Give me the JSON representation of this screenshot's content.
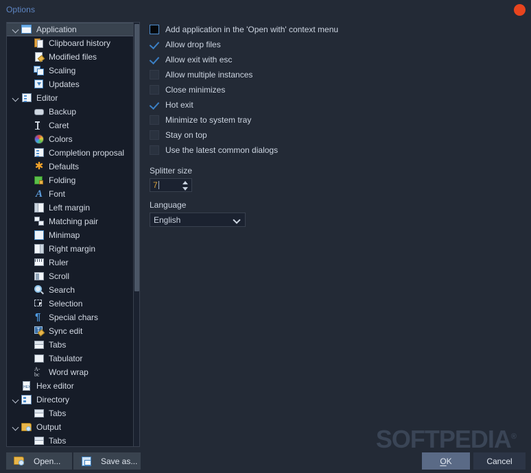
{
  "window": {
    "title": "Options",
    "close_icon": "close-circle-icon",
    "accent_close": "#e8441e",
    "accent_title": "#5e86c4",
    "background": "#232a36"
  },
  "tree": {
    "items": [
      {
        "label": "Application",
        "icon": "window-icon",
        "depth": 0,
        "expandable": true,
        "expanded": true,
        "selected": true
      },
      {
        "label": "Clipboard history",
        "icon": "clipboard-icon",
        "depth": 1,
        "expandable": false,
        "expanded": false,
        "selected": false
      },
      {
        "label": "Modified files",
        "icon": "document-edit-icon",
        "depth": 1,
        "expandable": false,
        "expanded": false,
        "selected": false
      },
      {
        "label": "Scaling",
        "icon": "scaling-icon",
        "depth": 1,
        "expandable": false,
        "expanded": false,
        "selected": false
      },
      {
        "label": "Updates",
        "icon": "updates-icon",
        "depth": 1,
        "expandable": false,
        "expanded": false,
        "selected": false
      },
      {
        "label": "Editor",
        "icon": "editor-icon",
        "depth": 0,
        "expandable": true,
        "expanded": true,
        "selected": false
      },
      {
        "label": "Backup",
        "icon": "backup-icon",
        "depth": 1,
        "expandable": false,
        "expanded": false,
        "selected": false
      },
      {
        "label": "Caret",
        "icon": "caret-icon",
        "depth": 1,
        "expandable": false,
        "expanded": false,
        "selected": false
      },
      {
        "label": "Colors",
        "icon": "colors-icon",
        "depth": 1,
        "expandable": false,
        "expanded": false,
        "selected": false
      },
      {
        "label": "Completion proposal",
        "icon": "completion-proposal-icon",
        "depth": 1,
        "expandable": false,
        "expanded": false,
        "selected": false
      },
      {
        "label": "Defaults",
        "icon": "defaults-icon",
        "depth": 1,
        "expandable": false,
        "expanded": false,
        "selected": false
      },
      {
        "label": "Folding",
        "icon": "folding-icon",
        "depth": 1,
        "expandable": false,
        "expanded": false,
        "selected": false
      },
      {
        "label": "Font",
        "icon": "font-icon",
        "depth": 1,
        "expandable": false,
        "expanded": false,
        "selected": false
      },
      {
        "label": "Left margin",
        "icon": "left-margin-icon",
        "depth": 1,
        "expandable": false,
        "expanded": false,
        "selected": false
      },
      {
        "label": "Matching pair",
        "icon": "matching-pair-icon",
        "depth": 1,
        "expandable": false,
        "expanded": false,
        "selected": false
      },
      {
        "label": "Minimap",
        "icon": "minimap-icon",
        "depth": 1,
        "expandable": false,
        "expanded": false,
        "selected": false
      },
      {
        "label": "Right margin",
        "icon": "right-margin-icon",
        "depth": 1,
        "expandable": false,
        "expanded": false,
        "selected": false
      },
      {
        "label": "Ruler",
        "icon": "ruler-icon",
        "depth": 1,
        "expandable": false,
        "expanded": false,
        "selected": false
      },
      {
        "label": "Scroll",
        "icon": "scroll-icon",
        "depth": 1,
        "expandable": false,
        "expanded": false,
        "selected": false
      },
      {
        "label": "Search",
        "icon": "search-icon",
        "depth": 1,
        "expandable": false,
        "expanded": false,
        "selected": false
      },
      {
        "label": "Selection",
        "icon": "selection-icon",
        "depth": 1,
        "expandable": false,
        "expanded": false,
        "selected": false
      },
      {
        "label": "Special chars",
        "icon": "pilcrow-icon",
        "depth": 1,
        "expandable": false,
        "expanded": false,
        "selected": false
      },
      {
        "label": "Sync edit",
        "icon": "sync-edit-icon",
        "depth": 1,
        "expandable": false,
        "expanded": false,
        "selected": false
      },
      {
        "label": "Tabs",
        "icon": "tabs-icon",
        "depth": 1,
        "expandable": false,
        "expanded": false,
        "selected": false
      },
      {
        "label": "Tabulator",
        "icon": "tabulator-icon",
        "depth": 1,
        "expandable": false,
        "expanded": false,
        "selected": false
      },
      {
        "label": "Word wrap",
        "icon": "word-wrap-icon",
        "depth": 1,
        "expandable": false,
        "expanded": false,
        "selected": false
      },
      {
        "label": "Hex editor",
        "icon": "hex-editor-icon",
        "depth": 0,
        "expandable": false,
        "expanded": false,
        "selected": false
      },
      {
        "label": "Directory",
        "icon": "directory-icon",
        "depth": 0,
        "expandable": true,
        "expanded": true,
        "selected": false
      },
      {
        "label": "Tabs",
        "icon": "tabs-icon",
        "depth": 1,
        "expandable": false,
        "expanded": false,
        "selected": false
      },
      {
        "label": "Output",
        "icon": "output-folder-icon",
        "depth": 0,
        "expandable": true,
        "expanded": true,
        "selected": false
      },
      {
        "label": "Tabs",
        "icon": "tabs-icon",
        "depth": 1,
        "expandable": false,
        "expanded": false,
        "selected": false
      }
    ]
  },
  "options": {
    "checkboxes": [
      {
        "label": "Add application in the 'Open with' context menu",
        "checked": false,
        "focused": true
      },
      {
        "label": "Allow drop files",
        "checked": true,
        "focused": false
      },
      {
        "label": "Allow exit with esc",
        "checked": true,
        "focused": false
      },
      {
        "label": "Allow multiple instances",
        "checked": false,
        "focused": false
      },
      {
        "label": "Close minimizes",
        "checked": false,
        "focused": false
      },
      {
        "label": "Hot exit",
        "checked": true,
        "focused": false
      },
      {
        "label": "Minimize to system tray",
        "checked": false,
        "focused": false
      },
      {
        "label": "Stay on top",
        "checked": false,
        "focused": false
      },
      {
        "label": "Use the latest common dialogs",
        "checked": false,
        "focused": false
      }
    ],
    "splitter_size": {
      "label": "Splitter size",
      "value": "7"
    },
    "language": {
      "label": "Language",
      "value": "English",
      "options": [
        "English"
      ]
    }
  },
  "footer": {
    "open_button": {
      "label": "Open...",
      "icon": "open-folder-icon"
    },
    "save_as_button": {
      "label": "Save as...",
      "icon": "save-disk-icon"
    },
    "ok_button": {
      "label": "OK",
      "accesskey": "O"
    },
    "cancel_button": {
      "label": "Cancel"
    }
  },
  "watermark": {
    "text": "SOFTPEDIA",
    "mark": "®"
  }
}
